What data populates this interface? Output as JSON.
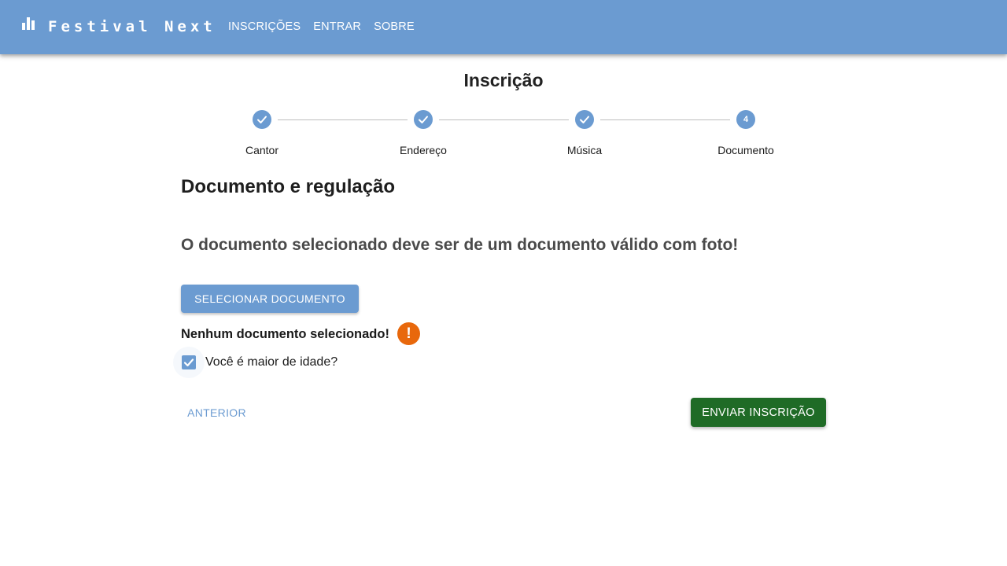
{
  "appbar": {
    "title": "Festival Next",
    "nav": [
      "INSCRIÇÕES",
      "ENTRAR",
      "SOBRE"
    ],
    "color": "#6b9bd1"
  },
  "page": {
    "title": "Inscrição"
  },
  "stepper": {
    "steps": [
      {
        "label": "Cantor",
        "state": "completed"
      },
      {
        "label": "Endereço",
        "state": "completed"
      },
      {
        "label": "Música",
        "state": "completed"
      },
      {
        "label": "Documento",
        "state": "active",
        "number": "4"
      }
    ]
  },
  "section": {
    "title": "Documento e regulação",
    "notice": "O documento selecionado deve ser de um documento válido com foto!",
    "select_button": "SELECIONAR DOCUMENTO",
    "status": "Nenhum documento selecionado!",
    "warning_symbol": "!",
    "adult_checkbox": {
      "label": "Você é maior de idade?",
      "checked": true
    }
  },
  "actions": {
    "previous": "ANTERIOR",
    "submit": "ENVIAR INSCRIÇÃO",
    "submit_color": "#1f6b26"
  },
  "colors": {
    "warning": "#e8680c"
  }
}
